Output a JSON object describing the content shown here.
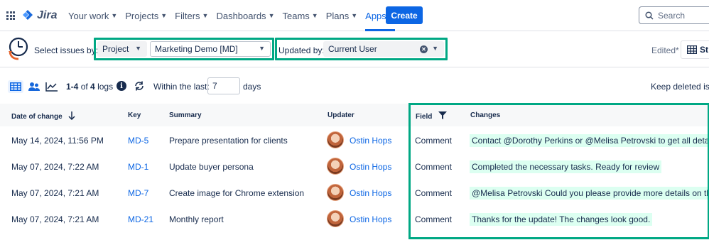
{
  "nav": {
    "logo": "Jira",
    "items": [
      {
        "label": "Your work"
      },
      {
        "label": "Projects"
      },
      {
        "label": "Filters"
      },
      {
        "label": "Dashboards"
      },
      {
        "label": "Teams"
      },
      {
        "label": "Plans"
      },
      {
        "label": "Apps"
      }
    ],
    "create_label": "Create",
    "search_placeholder": "Search"
  },
  "filter": {
    "select_label": "Select issues by:",
    "type_value": "Project",
    "project_value": "Marketing Demo [MD]",
    "updated_label": "Updated by:",
    "updated_value": "Current User",
    "edited_label": "Edited*",
    "st_button": "St"
  },
  "toolbar": {
    "logs_range": "1-4",
    "logs_of": "of",
    "logs_total": "4",
    "logs_suffix": "logs",
    "within_label": "Within the last:",
    "days_value": "7",
    "days_label": "days",
    "keep_deleted": "Keep deleted issu"
  },
  "table": {
    "headers": {
      "date": "Date of change",
      "key": "Key",
      "summary": "Summary",
      "updater": "Updater",
      "field": "Field",
      "changes": "Changes"
    },
    "rows": [
      {
        "date": "May 14, 2024, 11:56 PM",
        "key": "MD-5",
        "summary": "Prepare presentation for clients",
        "updater": "Ostin Hops",
        "field": "Comment",
        "change": "Contact @Dorothy Perkins or @Melisa Petrovski to get all details"
      },
      {
        "date": "May 07, 2024, 7:22 AM",
        "key": "MD-1",
        "summary": "Update buyer persona",
        "updater": "Ostin Hops",
        "field": "Comment",
        "change": "Completed the necessary tasks. Ready for review"
      },
      {
        "date": "May 07, 2024, 7:21 AM",
        "key": "MD-7",
        "summary": "Create image for Chrome extension",
        "updater": "Ostin Hops",
        "field": "Comment",
        "change": "@Melisa Petrovski Could you please provide more details on this?"
      },
      {
        "date": "May 07, 2024, 7:21 AM",
        "key": "MD-21",
        "summary": "Monthly report",
        "updater": "Ostin Hops",
        "field": "Comment",
        "change": "Thanks for the update! The changes look good."
      }
    ]
  },
  "colors": {
    "accent": "#0c66e4",
    "highlight_border": "#00a884",
    "change_bg": "#dcfff1"
  }
}
